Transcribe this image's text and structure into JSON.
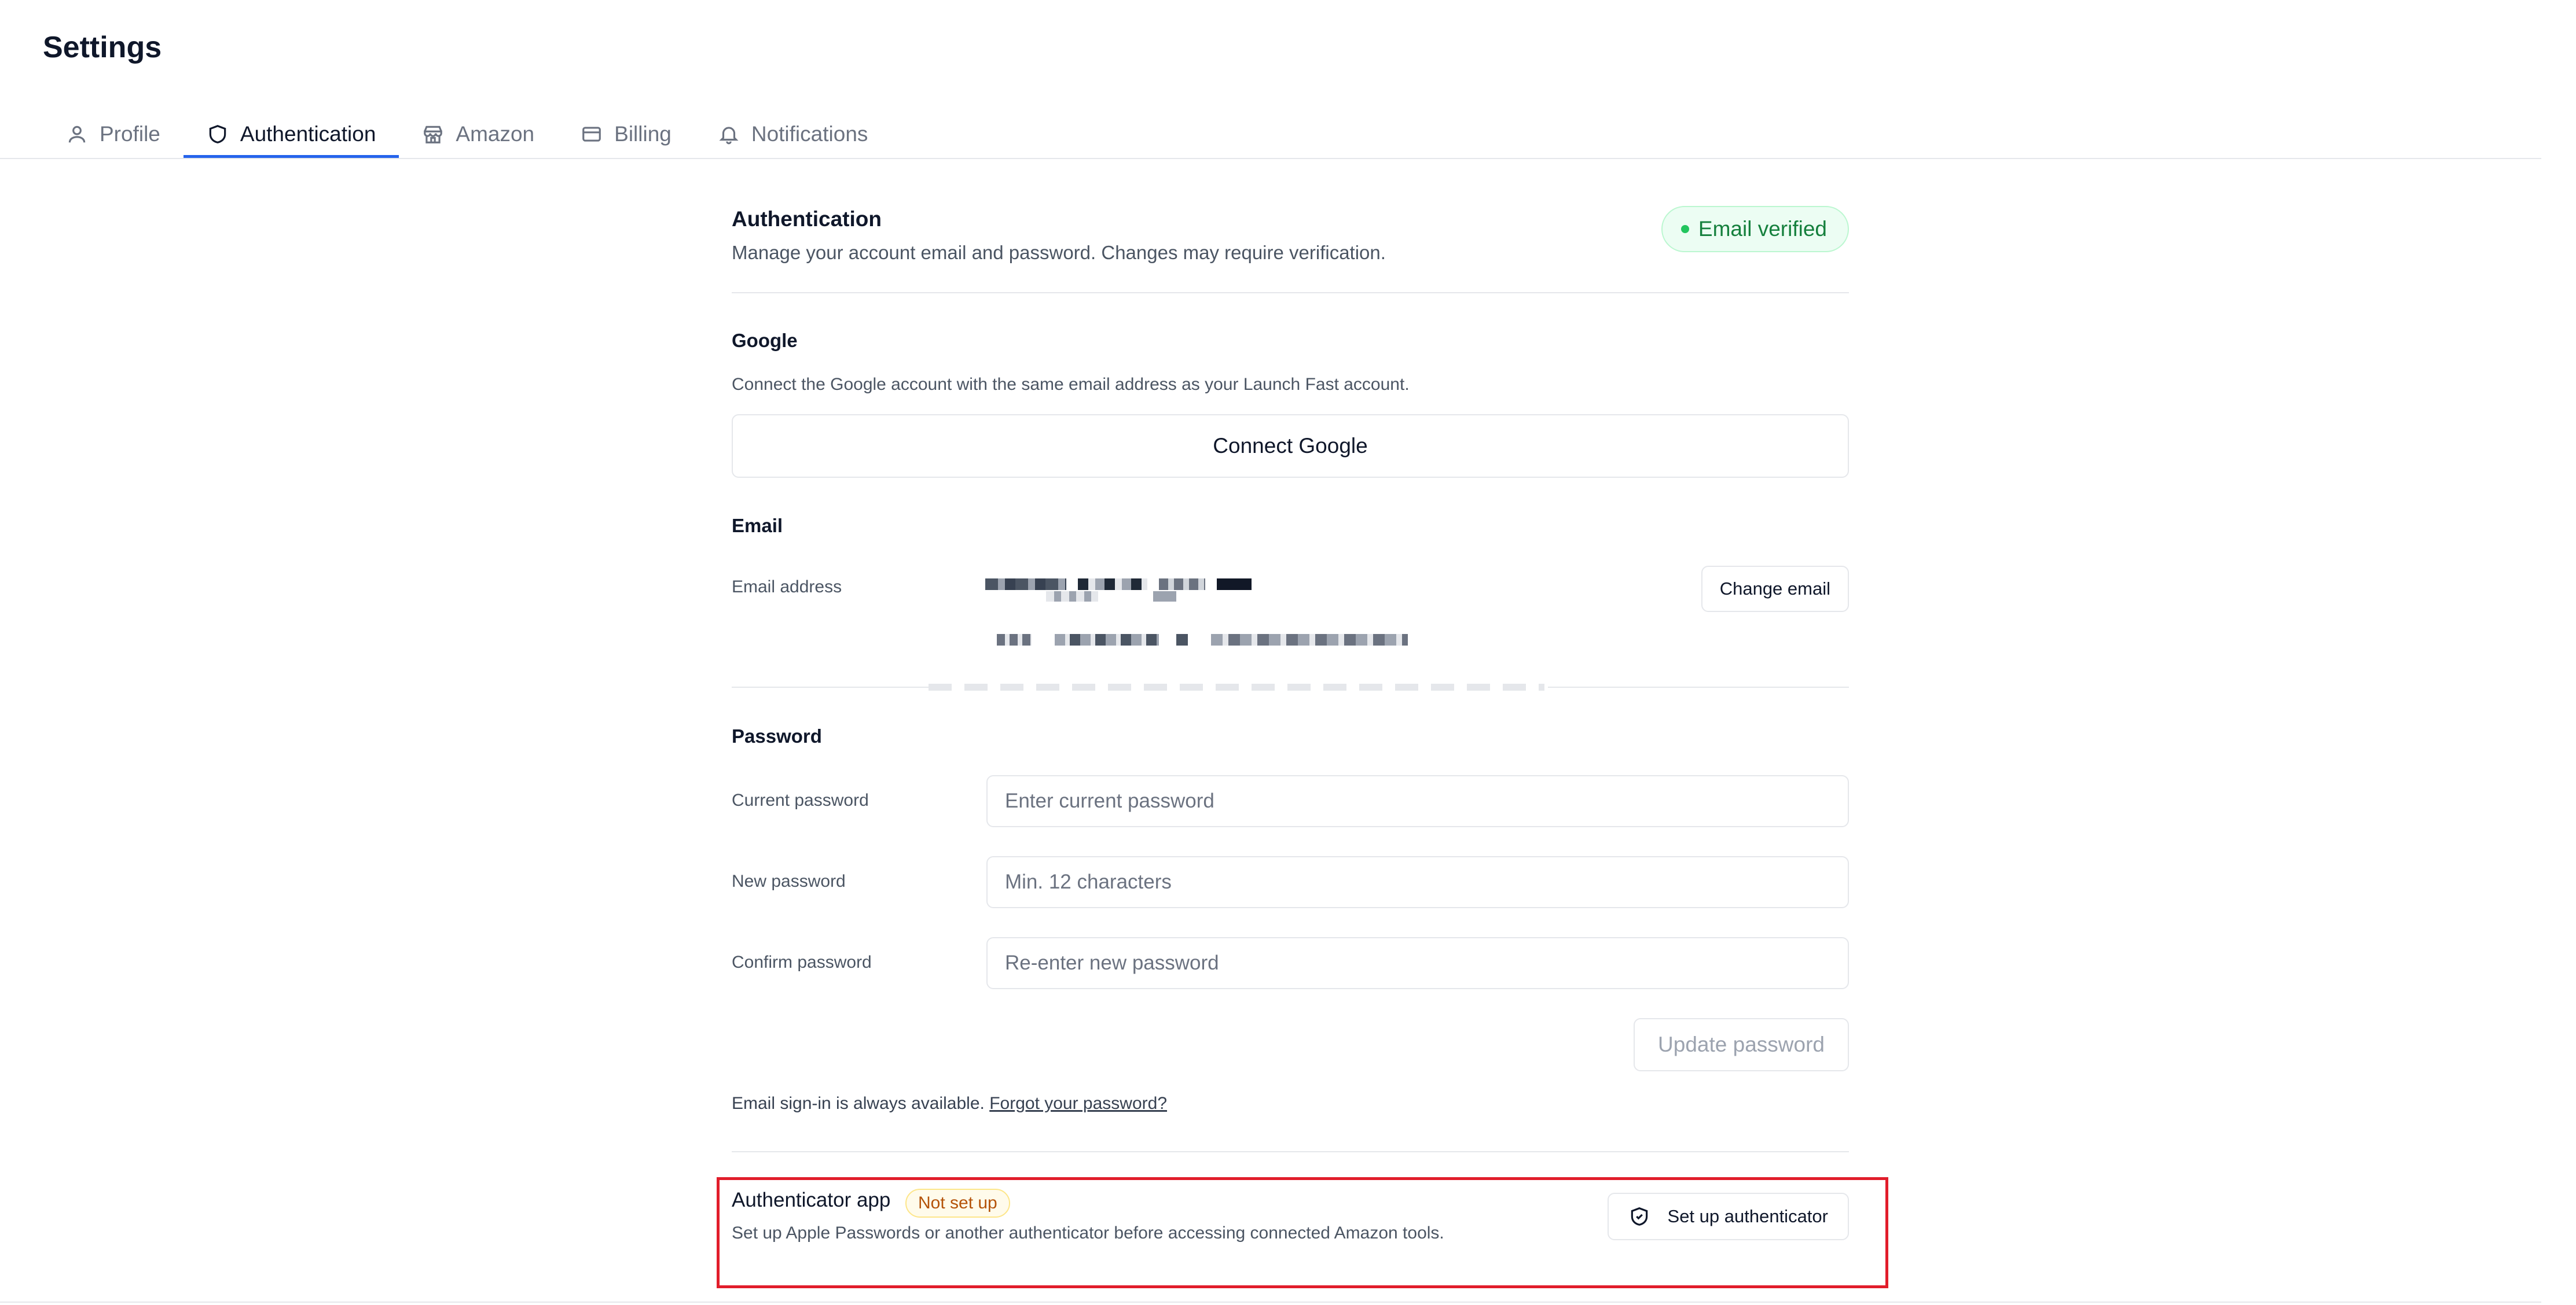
{
  "page": {
    "title": "Settings"
  },
  "tabs": [
    {
      "label": "Profile",
      "icon": "user-icon"
    },
    {
      "label": "Authentication",
      "icon": "shield-icon"
    },
    {
      "label": "Amazon",
      "icon": "store-icon"
    },
    {
      "label": "Billing",
      "icon": "credit-card-icon"
    },
    {
      "label": "Notifications",
      "icon": "bell-icon"
    }
  ],
  "active_tab": "Authentication",
  "auth": {
    "title": "Authentication",
    "description": "Manage your account email and password. Changes may require verification.",
    "status_badge": "Email verified"
  },
  "google": {
    "title": "Google",
    "description": "Connect the Google account with the same email address as your Launch Fast account.",
    "button": "Connect Google"
  },
  "email": {
    "title": "Email",
    "label": "Email address",
    "change_button": "Change email"
  },
  "password": {
    "title": "Password",
    "fields": [
      {
        "label": "Current password",
        "placeholder": "Enter current password"
      },
      {
        "label": "New password",
        "placeholder": "Min. 12 characters"
      },
      {
        "label": "Confirm password",
        "placeholder": "Re-enter new password"
      }
    ],
    "update_button": "Update password",
    "note": "Email sign-in is always available.",
    "forgot_link": "Forgot your password?"
  },
  "authenticator": {
    "title": "Authenticator app",
    "status_badge": "Not set up",
    "description": "Set up Apple Passwords or another authenticator before accessing connected Amazon tools.",
    "button": "Set up authenticator",
    "button_icon": "shield-check-icon"
  },
  "colors": {
    "accent": "#2563eb",
    "verified_green": "#15803d",
    "warning_amber": "#b45309",
    "highlight_red": "#e11d2b"
  }
}
